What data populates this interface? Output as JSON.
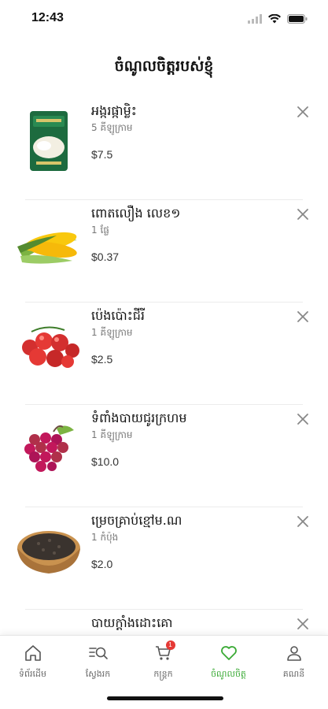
{
  "status_bar": {
    "time": "12:43"
  },
  "header": {
    "title": "ចំណូលចិត្តរបស់ខ្ញុំ"
  },
  "items": [
    {
      "name": "អង្ករផ្កាម្លិះ",
      "qty": "5 គីឡូក្រាម",
      "price": "$7.5",
      "image": "rice-bag"
    },
    {
      "name": "ពោតលឿង លេខ១",
      "qty": "1 ផ្លែ",
      "price": "$0.37",
      "image": "corn"
    },
    {
      "name": "ប៉េងប៉ោះជីរី",
      "qty": "1 គីឡូក្រាម",
      "price": "$2.5",
      "image": "cherry-tomato"
    },
    {
      "name": "ទំពាំងបាយជូរក្រហម",
      "qty": "1 គីឡូក្រាម",
      "price": "$10.0",
      "image": "red-grapes"
    },
    {
      "name": "ម្រេចគ្រាប់ខ្មៅម.ណ",
      "qty": "1 កំប៉ុង",
      "price": "$2.0",
      "image": "black-pepper"
    },
    {
      "name": "បាយក្តាំងដោះគោ",
      "qty": "",
      "price": "",
      "image": "rice-cracker"
    }
  ],
  "tabs": [
    {
      "label": "ទំព័រដើម",
      "icon": "home-icon",
      "active": false
    },
    {
      "label": "ស្វែងរក",
      "icon": "search-icon",
      "active": false
    },
    {
      "label": "កន្ត្រក",
      "icon": "cart-icon",
      "active": false,
      "badge": "1"
    },
    {
      "label": "ចំណូលចិត្ត",
      "icon": "heart-icon",
      "active": true
    },
    {
      "label": "គណនី",
      "icon": "user-icon",
      "active": false
    }
  ],
  "colors": {
    "accent": "#3aaa35",
    "badge": "#e53935"
  }
}
